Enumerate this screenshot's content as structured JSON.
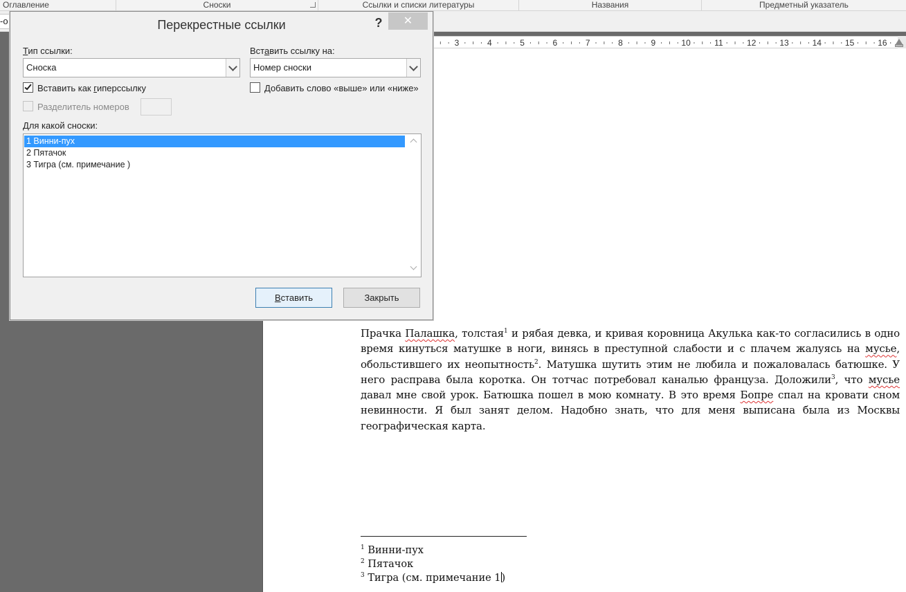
{
  "ribbon": {
    "groups": [
      "Оглавление",
      "Сноски",
      "Ссылки и списки литературы",
      "Названия",
      "Предметный указатель"
    ],
    "strip_fragment": "-о"
  },
  "ruler": {
    "ticks": [
      "3",
      "4",
      "5",
      "6",
      "7",
      "8",
      "9",
      "10",
      "11",
      "12",
      "13",
      "14",
      "15",
      "16"
    ]
  },
  "dialog": {
    "title": "Перекрестные ссылки",
    "help_glyph": "?",
    "close_glyph": "✕",
    "ref_type": {
      "label_ul": "Т",
      "label_rest": "ип ссылки:",
      "value": "Сноска"
    },
    "insert_ref_to": {
      "label_pre": "Вст",
      "label_ul": "а",
      "label_rest": "вить ссылку на:",
      "value": "Номер сноски"
    },
    "as_hyperlink": {
      "label_pre": "Вставить как ",
      "label_ul": "г",
      "label_rest": "иперссылку",
      "checked": true
    },
    "above_below": {
      "label_ul": "Д",
      "label_rest": "обавить слово «выше» или «ниже»",
      "checked": false
    },
    "separator": {
      "label": "Разделитель номеров",
      "enabled": false
    },
    "for_which": {
      "label_ul": "Д",
      "label_rest": "ля какой сноски:"
    },
    "list_items": [
      "1  Винни-пух",
      "2  Пятачок",
      "3  Тигра (см. примечание )"
    ],
    "selected_index": 0,
    "insert_button": {
      "ul": "В",
      "rest": "ставить"
    },
    "close_button": "Закрыть"
  },
  "document": {
    "p_1": "Прачка ",
    "p_2": "Палашка",
    "p_3": ", толстая",
    "p_sup1": "1",
    "p_4": " и рябая девка, и кривая коровница Акулька как-то согласились в одно время кинуться матушке в ноги, винясь в преступной слабости и с плачем жалуясь на ",
    "p_5": "мусье",
    "p_6": ", обольстившего их неопытность",
    "p_sup2": "2",
    "p_7": ". Матушка шутить этим не любила и пожаловалась батюшке. У него расправа была коротка. Он тотчас потребовал каналью француза. Доложили",
    "p_sup3": "3",
    "p_8": ", что ",
    "p_9": "мусье",
    "p_10": " давал мне свой урок. Батюшка пошел в мою комнату. В это время ",
    "p_11": "Бопре",
    "p_12": " спал на кровати сном невинности. Я был занят делом. Надобно знать, что для меня выписана была из Москвы географическая карта.",
    "footnotes": [
      {
        "num": "1",
        "text": " Винни-пух"
      },
      {
        "num": "2",
        "text": " Пятачок"
      },
      {
        "num": "3",
        "text": " Тигра (см. примечание 1"
      }
    ],
    "fn3_tail": ")"
  },
  "colors": {
    "selection": "#3399ff",
    "spellcheck": "#dd3333",
    "workspace": "#6a6a6a"
  }
}
